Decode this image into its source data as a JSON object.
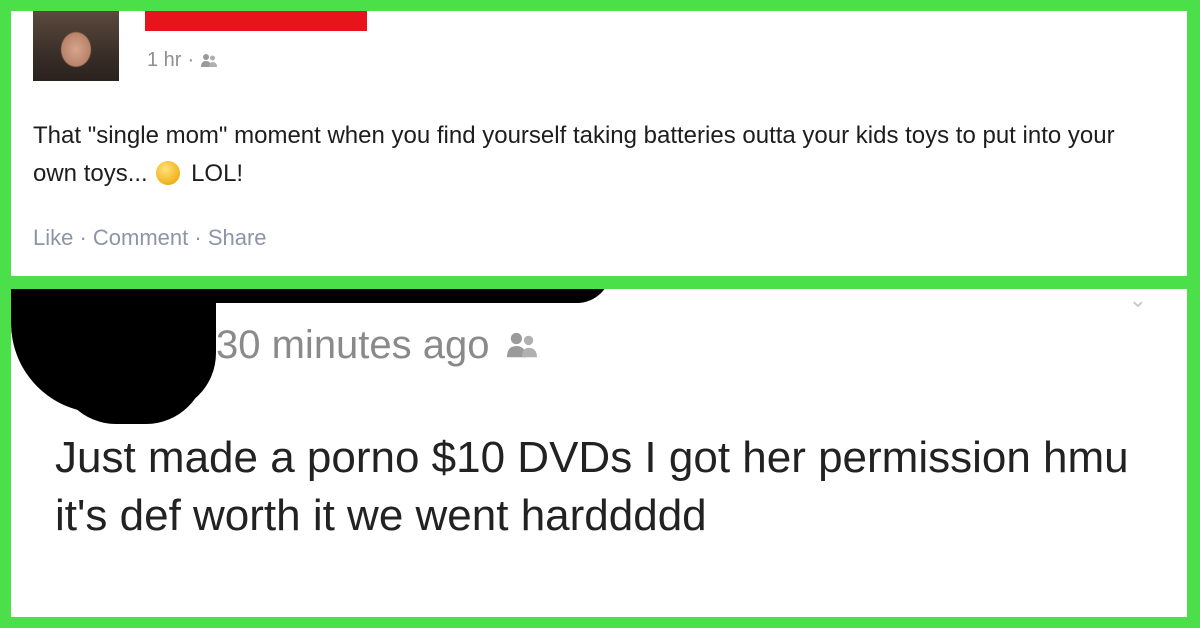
{
  "post1": {
    "time": "1 hr",
    "separator": "·",
    "text_before_emoji": "That \"single mom\" moment when you find yourself taking batteries outta your kids toys to put into your own toys...",
    "text_after_emoji": "LOL!",
    "actions": "Like · Comment · Share",
    "icon": "friends-icon",
    "name_bar_color": "#e8141b"
  },
  "post2": {
    "time": "30 minutes ago",
    "icon": "friends-icon",
    "text": "Just made a porno $10 DVDs I got her permission hmu it's def worth it we went harddddd"
  },
  "colors": {
    "frame": "#4be04a",
    "action_link": "#8c95a8"
  }
}
